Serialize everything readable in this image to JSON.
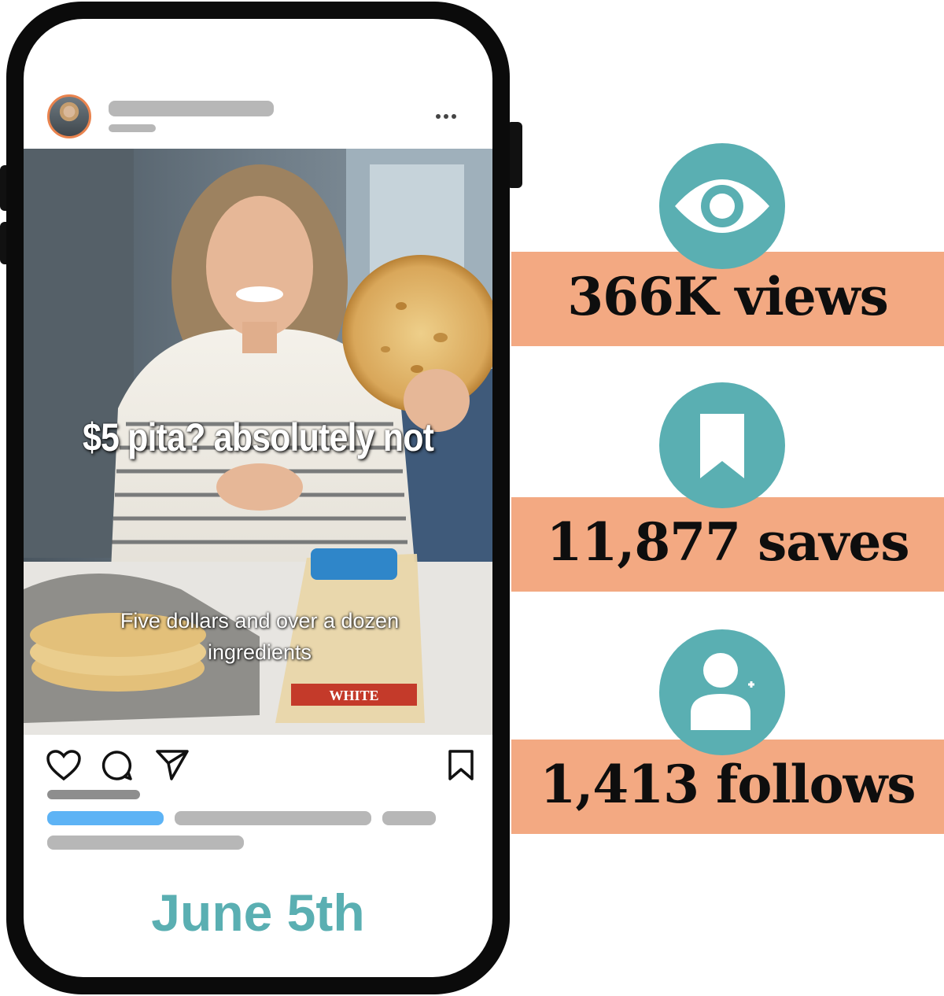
{
  "post": {
    "caption_main": "$5 pita? absolutely not",
    "caption_sub": "Five dollars and over a dozen ingredients",
    "bag_label": "WHITE",
    "date": "June 5th",
    "icons": [
      "more-icon",
      "heart-icon",
      "comment-icon",
      "share-icon",
      "bookmark-icon"
    ]
  },
  "stats": [
    {
      "icon": "eye-icon",
      "text": "366K views"
    },
    {
      "icon": "bookmark-icon",
      "text": "11,877 saves"
    },
    {
      "icon": "add-user-icon",
      "text": "1,413 follows"
    }
  ],
  "colors": {
    "accent_teal": "#5aafb2",
    "band_peach": "#f3a982",
    "avatar_ring": "#e9834e",
    "link_blue": "#5db3f5",
    "placeholder_gray": "#b7b7b7"
  }
}
